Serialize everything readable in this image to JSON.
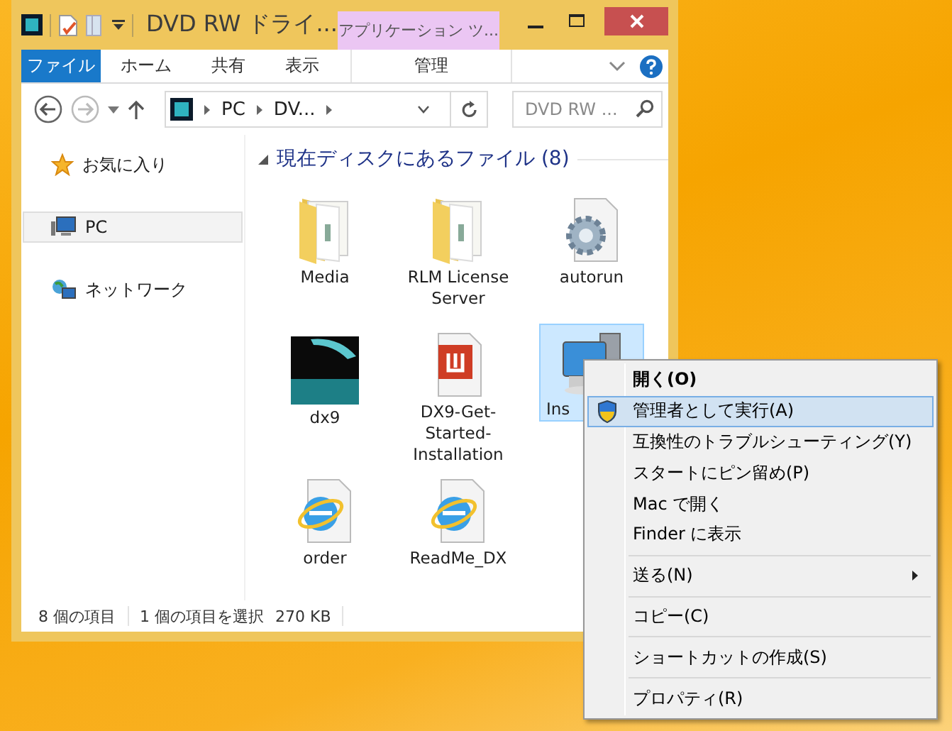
{
  "window": {
    "title": "DVD RW ドライ...",
    "contextual_tab": "アプリケーション ツ..."
  },
  "ribbon_tabs": [
    {
      "label": "ファイル",
      "kind": "file",
      "selected": false
    },
    {
      "label": "ホーム",
      "kind": "tab",
      "selected": false
    },
    {
      "label": "共有",
      "kind": "tab",
      "selected": false
    },
    {
      "label": "表示",
      "kind": "tab",
      "selected": false
    },
    {
      "label": "管理",
      "kind": "contextual",
      "selected": false
    }
  ],
  "address_bar": {
    "path": [
      "PC",
      "DV..."
    ]
  },
  "search": {
    "placeholder": "DVD RW ..."
  },
  "sidebar": {
    "items": [
      {
        "label": "お気に入り",
        "kind": "favorites",
        "selected": false
      },
      {
        "label": "PC",
        "kind": "pc",
        "selected": true
      },
      {
        "label": "ネットワーク",
        "kind": "network",
        "selected": false
      }
    ]
  },
  "group": {
    "title": "現在ディスクにあるファイル (8)",
    "expanded": true
  },
  "files": [
    {
      "name": "Media",
      "kind": "folder",
      "selected": false
    },
    {
      "name": "RLM License Server",
      "kind": "folder",
      "selected": false
    },
    {
      "name": "autorun",
      "kind": "settings",
      "selected": false
    },
    {
      "name": "dx9",
      "kind": "image",
      "selected": false
    },
    {
      "name": "DX9-Get-Started-Installation",
      "kind": "pdf",
      "selected": false
    },
    {
      "name": "Ins",
      "kind": "installer",
      "selected": true
    },
    {
      "name": "order",
      "kind": "web",
      "selected": false
    },
    {
      "name": "ReadMe_DX",
      "kind": "web",
      "selected": false
    }
  ],
  "status_bar": {
    "count": "8 個の項目",
    "selection": "1 個の項目を選択",
    "size": "270 KB"
  },
  "context_menu": {
    "items": [
      {
        "label": "開く(O)",
        "kind": "default",
        "selected": false
      },
      {
        "label": "管理者として実行(A)",
        "kind": "elevated",
        "selected": true
      },
      {
        "label": "互換性のトラブルシューティング(Y)",
        "kind": "item",
        "selected": false
      },
      {
        "label": "スタートにピン留め(P)",
        "kind": "item",
        "selected": false
      },
      {
        "label": "Mac で開く",
        "kind": "item",
        "selected": false
      },
      {
        "label": "Finder に表示",
        "kind": "item",
        "selected": false
      },
      {
        "kind": "separator"
      },
      {
        "label": "送る(N)",
        "kind": "submenu",
        "selected": false
      },
      {
        "kind": "separator"
      },
      {
        "label": "コピー(C)",
        "kind": "item",
        "selected": false
      },
      {
        "kind": "separator"
      },
      {
        "label": "ショートカットの作成(S)",
        "kind": "item",
        "selected": false
      },
      {
        "kind": "separator"
      },
      {
        "label": "プロパティ(R)",
        "kind": "item",
        "selected": false
      }
    ]
  }
}
